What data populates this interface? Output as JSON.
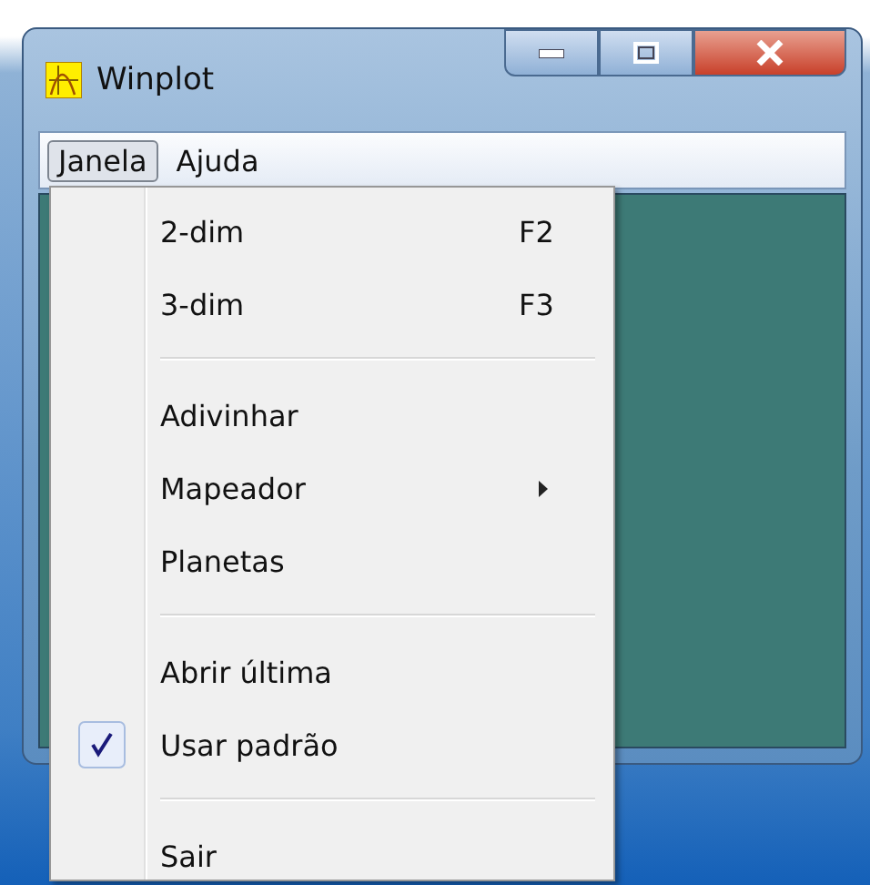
{
  "window": {
    "title": "Winplot"
  },
  "menu_bar": [
    {
      "label": "Janela",
      "selected": true
    },
    {
      "label": "Ajuda",
      "selected": false
    }
  ],
  "menu": [
    {
      "kind": "item",
      "label": "2-dim",
      "shortcut": "F2"
    },
    {
      "kind": "item",
      "label": "3-dim",
      "shortcut": "F3"
    },
    {
      "kind": "separator"
    },
    {
      "kind": "item",
      "label": "Adivinhar"
    },
    {
      "kind": "item",
      "label": "Mapeador",
      "submenu": true
    },
    {
      "kind": "item",
      "label": "Planetas"
    },
    {
      "kind": "separator"
    },
    {
      "kind": "item",
      "label": "Abrir última",
      "checked": false
    },
    {
      "kind": "item",
      "label": "Usar padrão",
      "checked": true
    },
    {
      "kind": "separator"
    },
    {
      "kind": "item",
      "label": "Sair"
    }
  ]
}
